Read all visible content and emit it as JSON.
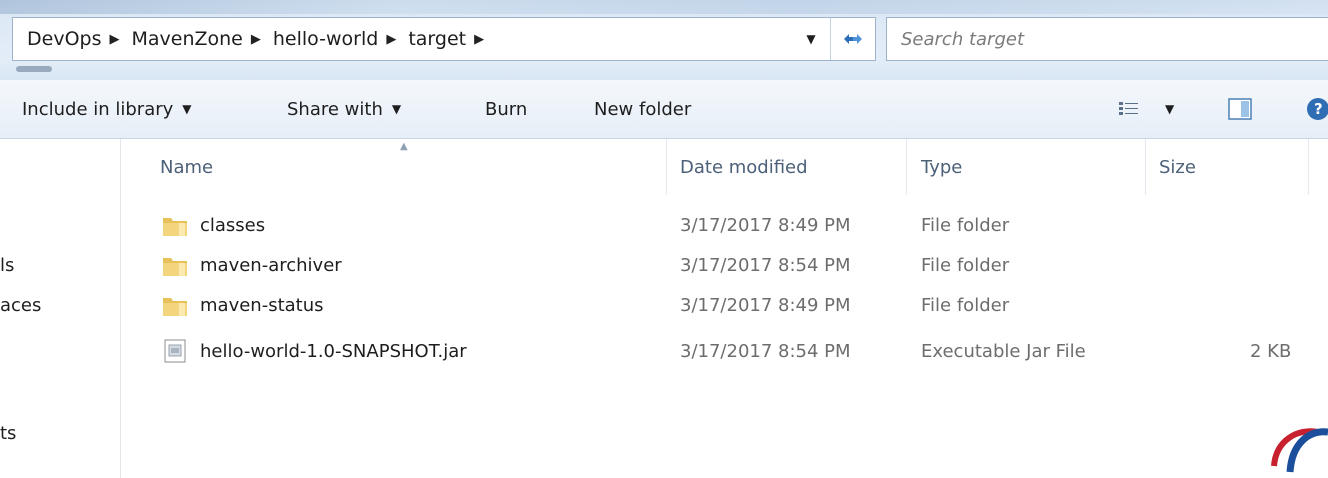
{
  "address_bar": {
    "crumbs": [
      "DevOps",
      "MavenZone",
      "hello-world",
      "target"
    ]
  },
  "search": {
    "placeholder": "Search target"
  },
  "toolbar": {
    "include_library": "Include in library",
    "share_with": "Share with",
    "burn": "Burn",
    "new_folder": "New folder"
  },
  "left_nav": [
    "ls",
    "aces",
    "ts"
  ],
  "columns": {
    "name": "Name",
    "date": "Date modified",
    "type": "Type",
    "size": "Size"
  },
  "files": [
    {
      "name": "classes",
      "date": "3/17/2017 8:49 PM",
      "type": "File folder",
      "size": "",
      "icon": "folder-icon"
    },
    {
      "name": "maven-archiver",
      "date": "3/17/2017 8:54 PM",
      "type": "File folder",
      "size": "",
      "icon": "folder-icon"
    },
    {
      "name": "maven-status",
      "date": "3/17/2017 8:49 PM",
      "type": "File folder",
      "size": "",
      "icon": "folder-icon"
    },
    {
      "name": "hello-world-1.0-SNAPSHOT.jar",
      "date": "3/17/2017 8:54 PM",
      "type": "Executable Jar File",
      "size": "2 KB",
      "icon": "jar-file-icon"
    }
  ],
  "colors": {
    "header_text": "#4c607a",
    "folder": "#e8c15a",
    "chrome": "#dce8f5"
  }
}
